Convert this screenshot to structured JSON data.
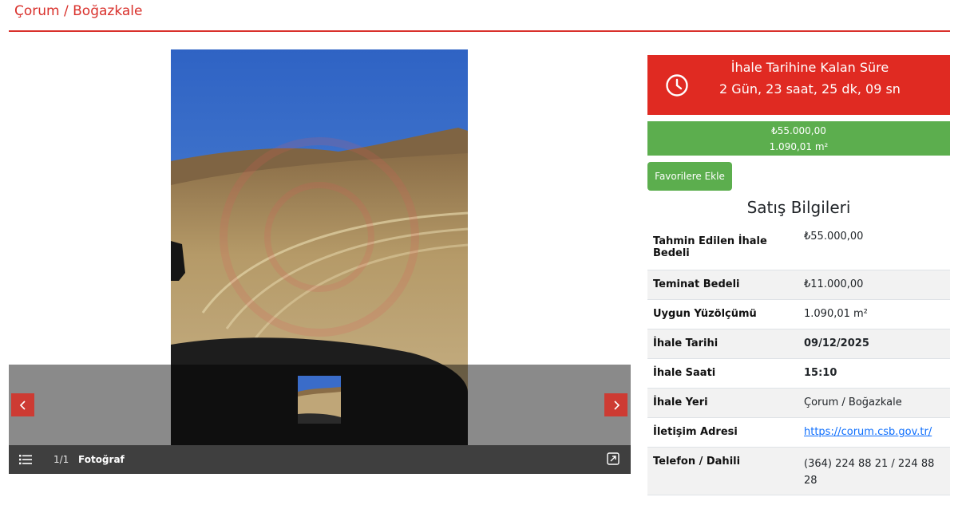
{
  "page": {
    "title": "Çorum / Boğazkale"
  },
  "gallery": {
    "counter": "1/1",
    "caption": "Fotoğraf",
    "icons": {
      "prev": "chevron-left-icon",
      "next": "chevron-right-icon",
      "list": "list-icon",
      "expand": "expand-icon"
    }
  },
  "countdown": {
    "label": "İhale Tarihine Kalan Süre",
    "value": "2 Gün, 23 saat, 25 dk, 09 sn",
    "icon": "clock-icon"
  },
  "price": {
    "amount": "₺55.000,00",
    "area": "1.090,01 m²"
  },
  "favorite_button": "Favorilere Ekle",
  "sales_info": {
    "title": "Satış Bilgileri",
    "rows": [
      {
        "label": "Tahmin Edilen İhale Bedeli",
        "value": "₺55.000,00"
      },
      {
        "label": "Teminat Bedeli",
        "value": "₺11.000,00"
      },
      {
        "label": "Uygun Yüzölçümü",
        "value": "1.090,01 m²"
      },
      {
        "label": "İhale Tarihi",
        "value": "09/12/2025"
      },
      {
        "label": "İhale Saati",
        "value": "15:10"
      },
      {
        "label": "İhale Yeri",
        "value": "Çorum / Boğazkale"
      },
      {
        "label": "İletişim Adresi",
        "value": "https://corum.csb.gov.tr/"
      },
      {
        "label": "Telefon / Dahili",
        "value": "(364) 224 88 21 / 224 88 28"
      }
    ]
  },
  "colors": {
    "accent_red": "#d9302b",
    "countdown_red": "#e02a22",
    "green": "#5cae4e",
    "link": "#0d6efd"
  }
}
